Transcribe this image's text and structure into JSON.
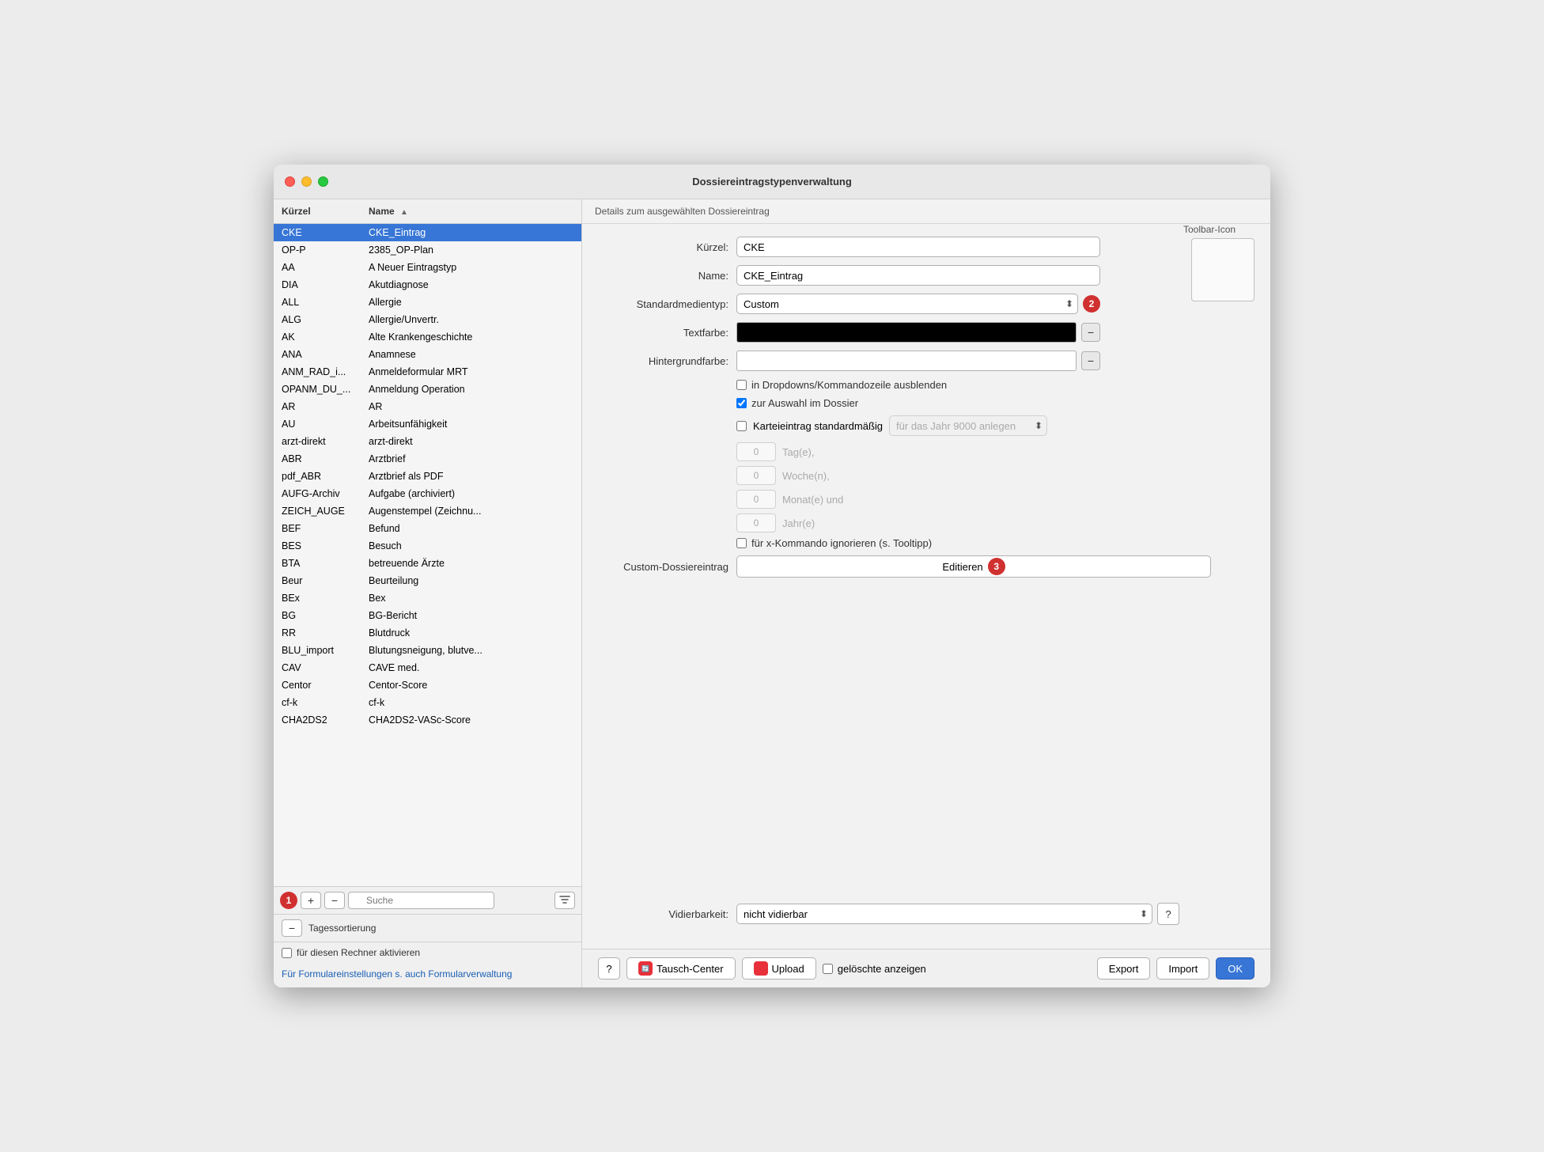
{
  "window": {
    "title": "Dossiereintragstypenverwaltung"
  },
  "left_panel": {
    "col1_header": "Kürzel",
    "col2_header": "Name",
    "items": [
      {
        "kuerzel": "CKE",
        "name": "CKE_Eintrag",
        "selected": true
      },
      {
        "kuerzel": "OP-P",
        "name": "2385_OP-Plan"
      },
      {
        "kuerzel": "AA",
        "name": "A Neuer Eintragstyp"
      },
      {
        "kuerzel": "DIA",
        "name": "Akutdiagnose"
      },
      {
        "kuerzel": "ALL",
        "name": "Allergie"
      },
      {
        "kuerzel": "ALG",
        "name": "Allergie/Unvertr."
      },
      {
        "kuerzel": "AK",
        "name": "Alte Krankengeschichte"
      },
      {
        "kuerzel": "ANA",
        "name": "Anamnese"
      },
      {
        "kuerzel": "ANM_RAD_i...",
        "name": "Anmeldeformular MRT"
      },
      {
        "kuerzel": "OPANM_DU_...",
        "name": "Anmeldung Operation"
      },
      {
        "kuerzel": "AR",
        "name": "AR"
      },
      {
        "kuerzel": "AU",
        "name": "Arbeitsunfähigkeit"
      },
      {
        "kuerzel": "arzt-direkt",
        "name": "arzt-direkt"
      },
      {
        "kuerzel": "ABR",
        "name": "Arztbrief"
      },
      {
        "kuerzel": "pdf_ABR",
        "name": "Arztbrief als PDF"
      },
      {
        "kuerzel": "AUFG-Archiv",
        "name": "Aufgabe (archiviert)"
      },
      {
        "kuerzel": "ZEICH_AUGE",
        "name": "Augenstempel (Zeichnu..."
      },
      {
        "kuerzel": "BEF",
        "name": "Befund"
      },
      {
        "kuerzel": "BES",
        "name": "Besuch"
      },
      {
        "kuerzel": "BTA",
        "name": "betreuende Ärzte"
      },
      {
        "kuerzel": "Beur",
        "name": "Beurteilung"
      },
      {
        "kuerzel": "BEx",
        "name": "Bex"
      },
      {
        "kuerzel": "BG",
        "name": "BG-Bericht"
      },
      {
        "kuerzel": "RR",
        "name": "Blutdruck"
      },
      {
        "kuerzel": "BLU_import",
        "name": "Blutungsneigung, blutve..."
      },
      {
        "kuerzel": "CAV",
        "name": "CAVE med."
      },
      {
        "kuerzel": "Centor",
        "name": "Centor-Score"
      },
      {
        "kuerzel": "cf-k",
        "name": "cf-k"
      },
      {
        "kuerzel": "CHA2DS2",
        "name": "CHA2DS2-VASc-Score"
      }
    ],
    "toolbar": {
      "add_label": "+",
      "remove_label": "−",
      "search_placeholder": "Suche"
    },
    "tag_sortierung_label": "Tagessortierung",
    "activate_label": "für diesen Rechner aktivieren",
    "formular_link": "Für Formulareinstellungen s. auch Formularverwaltung"
  },
  "right_panel": {
    "header": "Details zum ausgewählten Dossiereintrag",
    "toolbar_icon_label": "Toolbar-Icon",
    "fields": {
      "kuerzel_label": "Kürzel:",
      "kuerzel_value": "CKE",
      "name_label": "Name:",
      "name_value": "CKE_Eintrag",
      "standardmedientyp_label": "Standardmedientyp:",
      "standardmedientyp_value": "Custom",
      "textfarbe_label": "Textfarbe:",
      "hintergrundfarbe_label": "Hintergrundfarbe:",
      "checkbox1_label": "in Dropdowns/Kommandozeile ausblenden",
      "checkbox2_label": "zur Auswahl im Dossier",
      "checkbox3_label": "Karteieintrag standardmäßig",
      "fuer_das_jahr_placeholder": "für das Jahr 9000 anlegen",
      "tag_label": "Tag(e),",
      "woche_label": "Woche(n),",
      "monat_label": "Monat(e) und",
      "jahr_label": "Jahr(e)",
      "x_kommando_label": "für x-Kommando ignorieren (s. Tooltipp)",
      "custom_label": "Custom-Dossiereintrag",
      "editieren_label": "Editieren",
      "vidierbarkeit_label": "Vidierbarkeit:",
      "vidierbarkeit_value": "nicht vidierbar",
      "num_0_1": "0",
      "num_0_2": "0",
      "num_0_3": "0",
      "num_0_4": "0"
    },
    "bottom_bar": {
      "question_label": "?",
      "tausch_center_label": "Tausch-Center",
      "upload_label": "Upload",
      "export_label": "Export",
      "import_label": "Import",
      "ok_label": "OK",
      "geloschte_label": "gelöschte anzeigen"
    }
  },
  "badges": {
    "badge1": "1",
    "badge2": "2",
    "badge3": "3",
    "badge_color": "#d03030"
  }
}
